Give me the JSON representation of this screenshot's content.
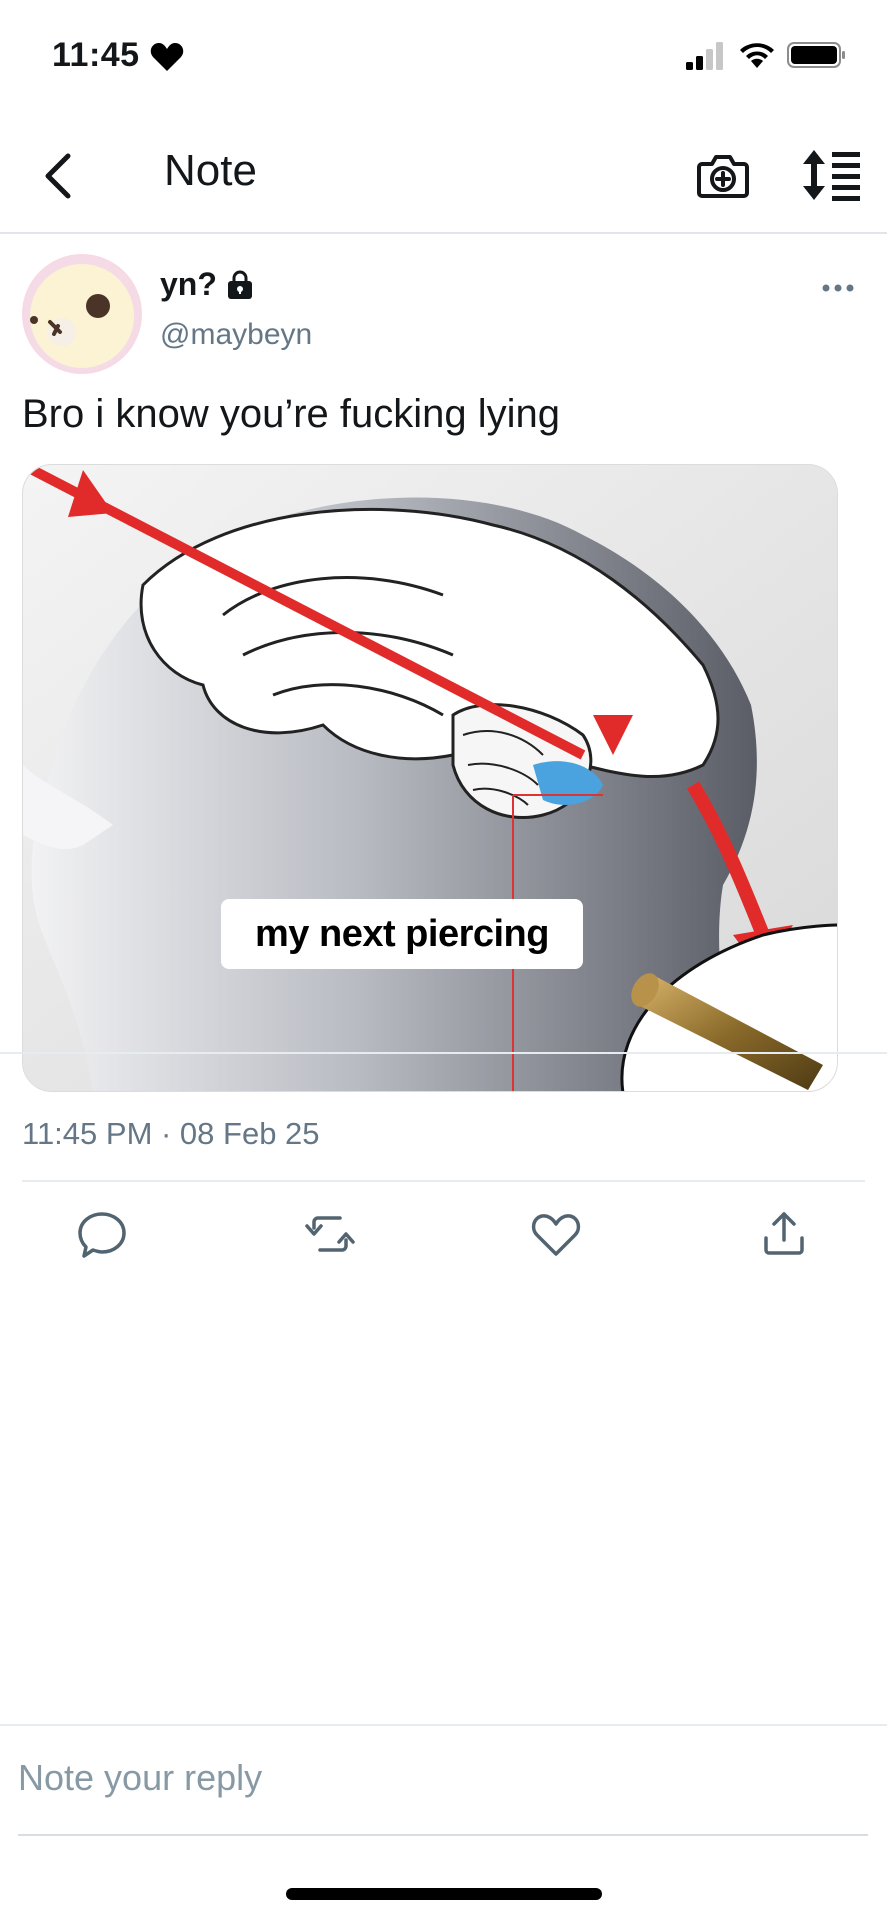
{
  "status_bar": {
    "time": "11:45",
    "icons": [
      "heart-icon",
      "cellular-signal-icon",
      "wifi-icon",
      "battery-icon"
    ]
  },
  "nav": {
    "title": "Note",
    "back_icon": "chevron-left-icon",
    "camera_icon": "camera-plus-icon",
    "sort_icon": "sort-arrows-icon"
  },
  "post": {
    "display_name": "yn?",
    "protected_icon": "lock-icon",
    "handle": "@maybeyn",
    "text": "Bro i know you’re fucking lying",
    "media": {
      "caption": "my next piercing",
      "description_icon": "meme-image"
    },
    "timestamp": "11:45 PM · 08 Feb 25",
    "actions": [
      {
        "name": "reply",
        "icon": "comment-icon"
      },
      {
        "name": "retweet",
        "icon": "retweet-icon"
      },
      {
        "name": "like",
        "icon": "heart-outline-icon"
      },
      {
        "name": "share",
        "icon": "share-upload-icon"
      }
    ]
  },
  "reply": {
    "placeholder": "Note your reply",
    "value": ""
  },
  "colors": {
    "text_primary": "#14171a",
    "text_secondary": "#657786",
    "divider": "#e6ecf0",
    "avatar_bg": "#f7d9e5"
  }
}
